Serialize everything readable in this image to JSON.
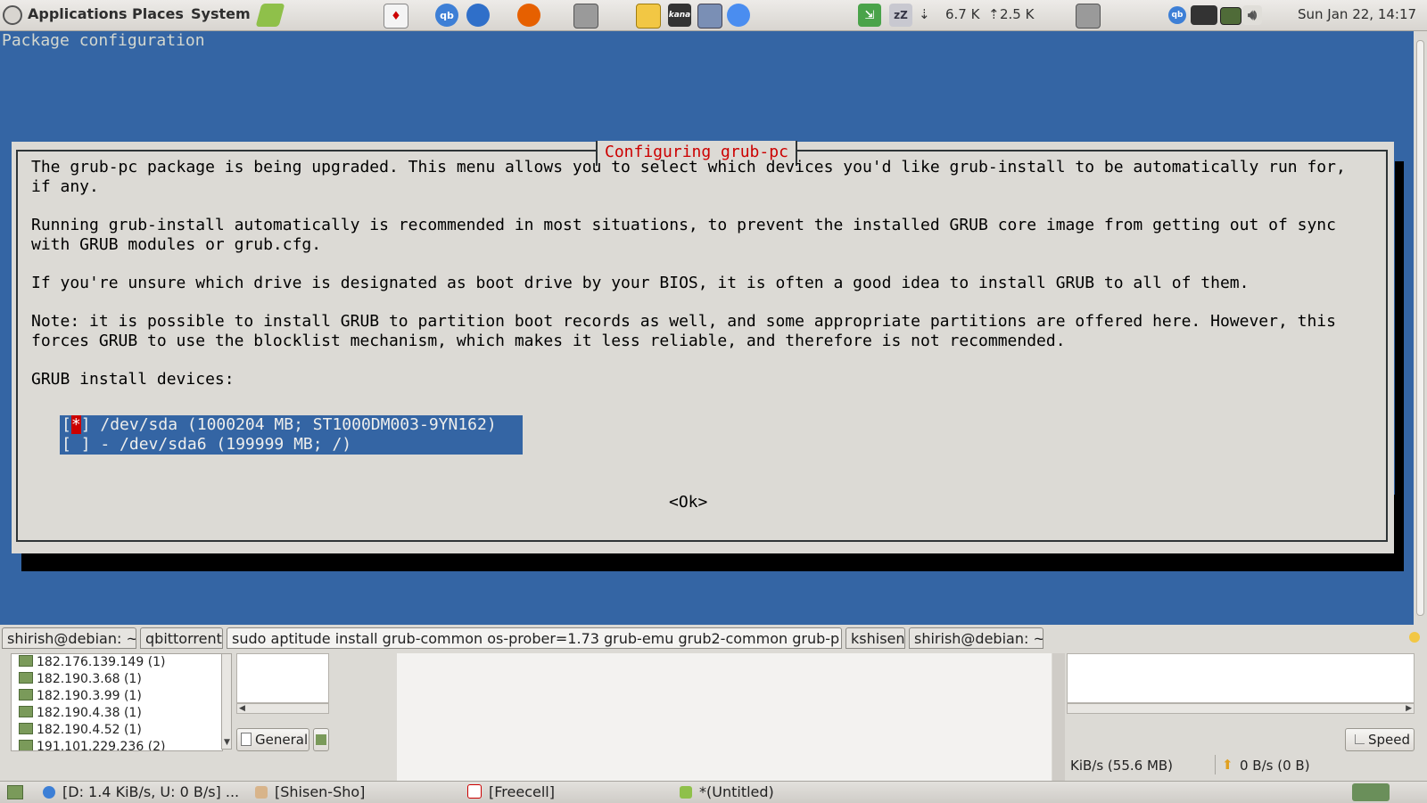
{
  "top_panel": {
    "menus": [
      "Applications",
      "Places",
      "System"
    ],
    "net_down": "6.7 K",
    "net_up": "2.5 K",
    "clock": "Sun Jan 22, 14:17",
    "launcher_icons": [
      "debian-logo-icon",
      "text-editor-icon",
      "cards-game-icon",
      "qbittorrent-icon",
      "browser-icon",
      "firefox-icon",
      "screenshot-icon",
      "mahjongg-icon",
      "kana-icon",
      "calculator-icon",
      "chromium-icon",
      "exit-icon",
      "sleep-icon",
      "screenshot-icon-2"
    ],
    "tray_icons": [
      "qbittorrent-tray-icon",
      "network-icon",
      "battery-icon",
      "volume-icon"
    ]
  },
  "terminal": {
    "title": "Package configuration",
    "colors": {
      "background": "#3465a4",
      "dialog": "#dcdad5",
      "title_red": "#cc0000"
    },
    "dialog": {
      "title": "Configuring grub-pc",
      "paragraphs": [
        "The grub-pc package is being upgraded. This menu allows you to select which devices you'd like grub-install to be automatically run for,\nif any.",
        "Running grub-install automatically is recommended in most situations, to prevent the installed GRUB core image from getting out of sync\nwith GRUB modules or grub.cfg.",
        "If you're unsure which drive is designated as boot drive by your BIOS, it is often a good idea to install GRUB to all of them.",
        "Note: it is possible to install GRUB to partition boot records as well, and some appropriate partitions are offered here. However, this\nforces GRUB to use the blocklist mechanism, which makes it less reliable, and therefore is not recommended.",
        "GRUB install devices:"
      ],
      "devices": [
        {
          "checked_mark": "*",
          "label": "] /dev/sda (1000204 MB; ST1000DM003-9YN162)"
        },
        {
          "checked_mark": " ",
          "label": "] - /dev/sda6 (199999 MB; /)"
        }
      ],
      "ok_label": "<Ok>"
    }
  },
  "tabs": [
    "shirish@debian: ~",
    "qbittorrent",
    "sudo aptitude install grub-common os-prober=1.73 grub-emu grub2-common grub-p",
    "kshisen",
    "shirish@debian: ~"
  ],
  "qbittorrent": {
    "peers": [
      "182.176.139.149 (1)",
      "182.190.3.68 (1)",
      "182.190.3.99 (1)",
      "182.190.4.38 (1)",
      "182.190.4.52 (1)",
      "191.101.229.236 (2)"
    ],
    "general_button": "General",
    "speed_button": "Speed",
    "status_down": "KiB/s (55.6 MB)",
    "status_up": "0 B/s (0 B)"
  },
  "taskbar": {
    "items": [
      "[D: 1.4 KiB/s, U: 0 B/s] ...",
      "[Shisen-Sho]",
      "[Freecell]",
      "*(Untitled)"
    ]
  }
}
